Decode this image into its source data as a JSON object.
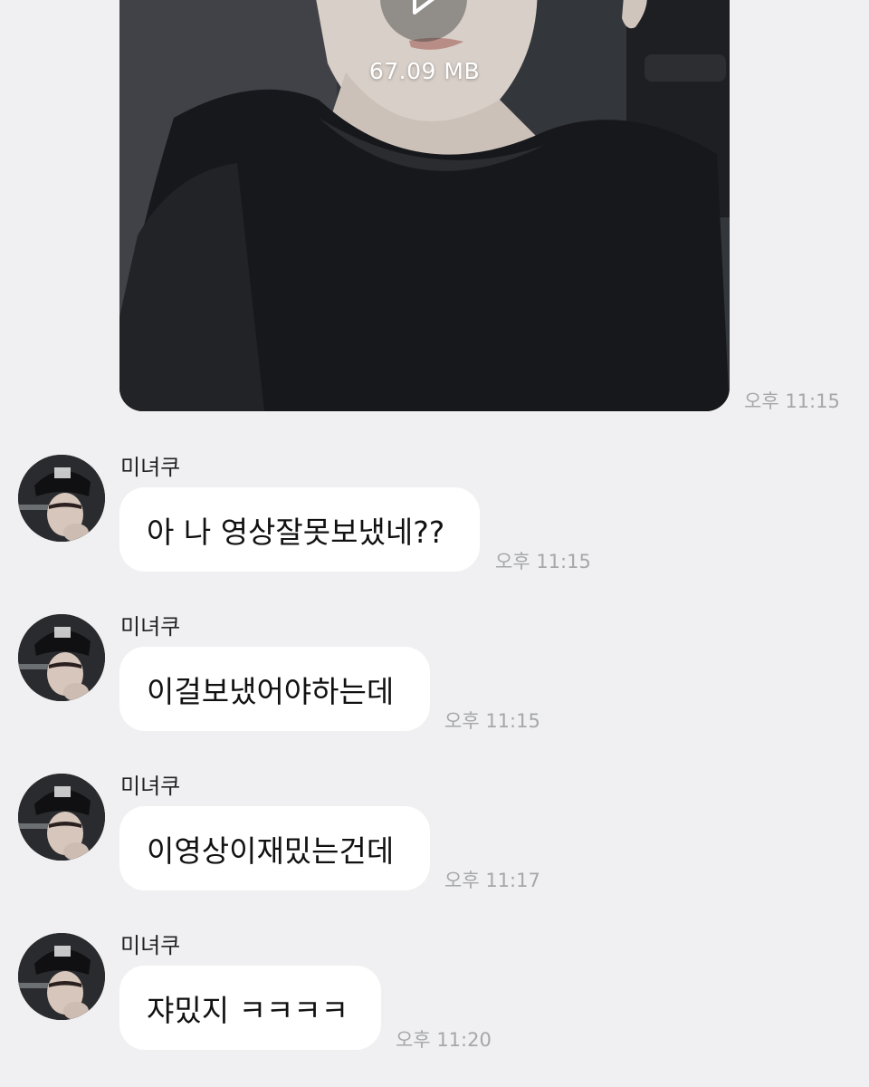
{
  "video_message": {
    "file_size": "67.09 MB",
    "timestamp": "오후 11:15"
  },
  "messages": [
    {
      "sender": "미녀쿠",
      "text": "아 나 영상잘못보냈네??",
      "timestamp": "오후 11:15"
    },
    {
      "sender": "미녀쿠",
      "text": "이걸보냈어야하는데",
      "timestamp": "오후 11:15"
    },
    {
      "sender": "미녀쿠",
      "text": "이영상이재밌는건데",
      "timestamp": "오후 11:17"
    },
    {
      "sender": "미녀쿠",
      "text": "쟈밌지 ㅋㅋㅋㅋ",
      "timestamp": "오후 11:20"
    }
  ],
  "colors": {
    "background": "#f0f0f2",
    "bubble": "#ffffff",
    "timestamp": "#a6a7ab"
  }
}
